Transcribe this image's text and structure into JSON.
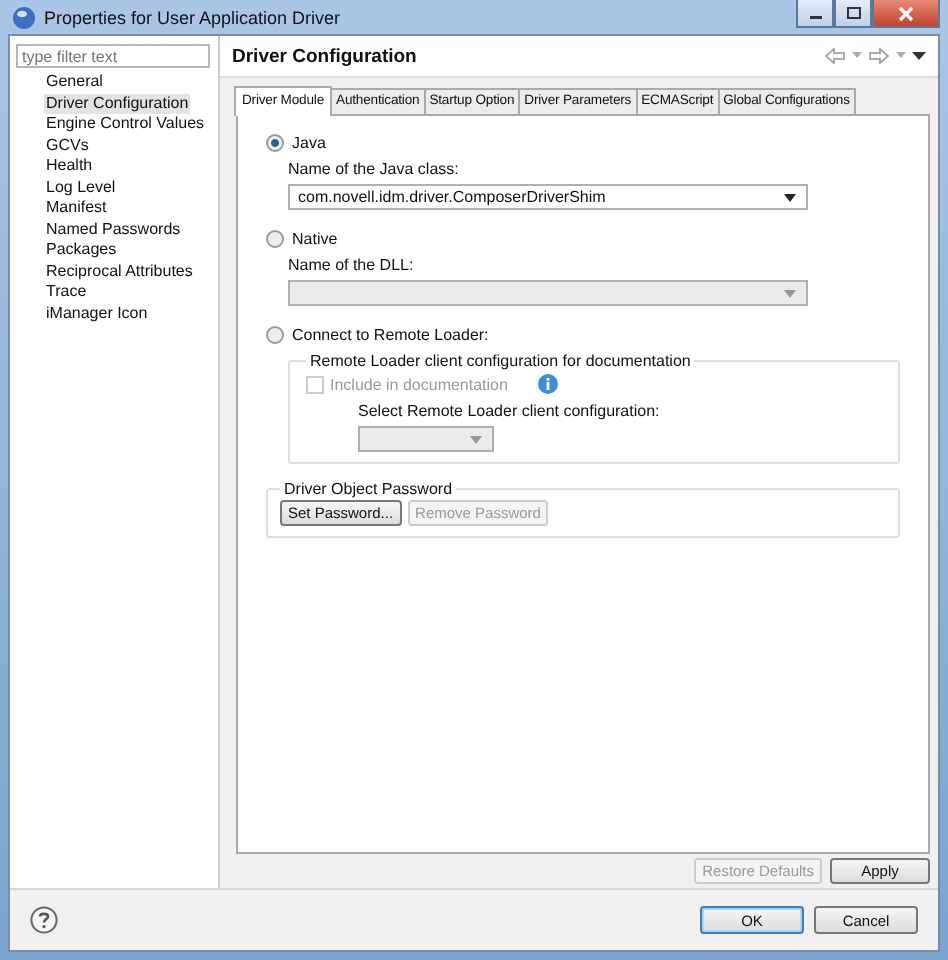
{
  "window": {
    "title": "Properties for User Application Driver"
  },
  "filter": {
    "placeholder": "type filter text"
  },
  "sidebar": {
    "items": [
      {
        "label": "General",
        "selected": false
      },
      {
        "label": "Driver Configuration",
        "selected": true
      },
      {
        "label": "Engine Control Values",
        "selected": false
      },
      {
        "label": "GCVs",
        "selected": false
      },
      {
        "label": "Health",
        "selected": false
      },
      {
        "label": "Log Level",
        "selected": false
      },
      {
        "label": "Manifest",
        "selected": false
      },
      {
        "label": "Named Passwords",
        "selected": false
      },
      {
        "label": "Packages",
        "selected": false
      },
      {
        "label": "Reciprocal Attributes",
        "selected": false
      },
      {
        "label": "Trace",
        "selected": false
      },
      {
        "label": "iManager Icon",
        "selected": false
      }
    ]
  },
  "page": {
    "title": "Driver Configuration"
  },
  "tabs": [
    {
      "label": "Driver Module",
      "selected": true
    },
    {
      "label": "Authentication",
      "selected": false
    },
    {
      "label": "Startup Option",
      "selected": false
    },
    {
      "label": "Driver Parameters",
      "selected": false
    },
    {
      "label": "ECMAScript",
      "selected": false
    },
    {
      "label": "Global Configurations",
      "selected": false
    }
  ],
  "java": {
    "label": "Java",
    "selected": true,
    "field_label": "Name of the Java class:",
    "value": "com.novell.idm.driver.ComposerDriverShim",
    "disabled": false
  },
  "native": {
    "label": "Native",
    "selected": false,
    "field_label": "Name of the DLL:",
    "disabled": true
  },
  "remote": {
    "label": "Connect to Remote Loader:",
    "selected": false,
    "group_title": "Remote Loader client configuration for documentation",
    "include": {
      "label": "Include in documentation",
      "checked": false,
      "disabled": true
    },
    "select_label": "Select Remote Loader client configuration:",
    "select_disabled": true
  },
  "password": {
    "title": "Driver Object Password",
    "buttons": [
      {
        "label": "Set Password...",
        "disabled": false
      },
      {
        "label": "Remove Password",
        "disabled": true
      }
    ]
  },
  "page_buttons": [
    {
      "label": "Restore Defaults",
      "disabled": true
    },
    {
      "label": "Apply",
      "disabled": false
    }
  ],
  "dialog_buttons": [
    {
      "label": "OK",
      "default": true
    },
    {
      "label": "Cancel",
      "default": false
    }
  ]
}
